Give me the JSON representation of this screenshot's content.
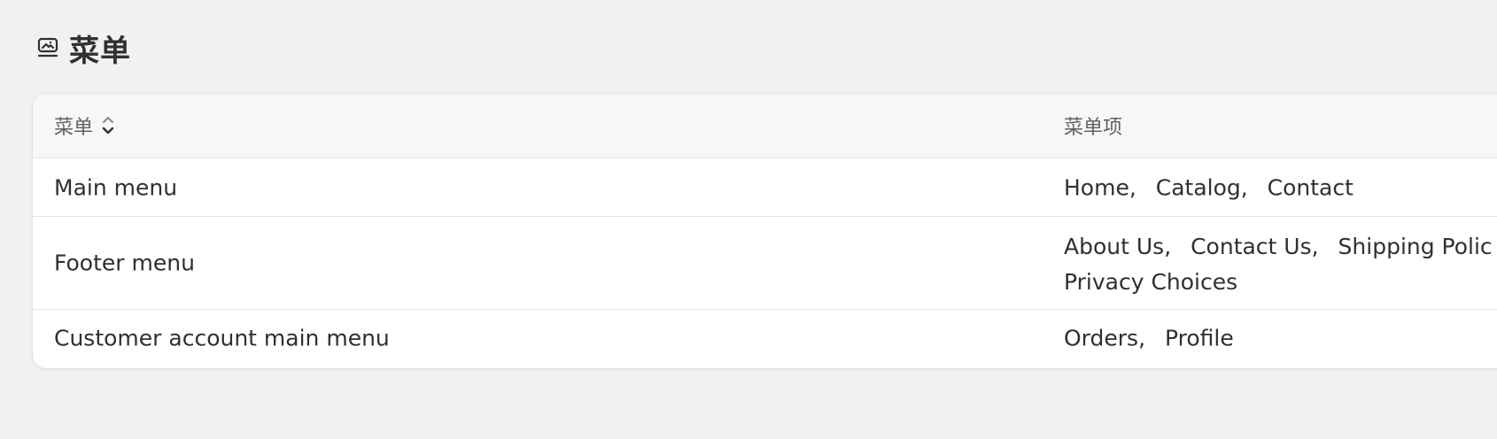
{
  "header": {
    "icon": "menu-list-icon",
    "title": "菜单"
  },
  "table": {
    "columns": {
      "menu": "菜单",
      "items": "菜单项"
    },
    "sort_icon": "sort-icon",
    "separator": ",",
    "rows": [
      {
        "name": "Main menu",
        "items": [
          "Home",
          "Catalog",
          "Contact"
        ]
      },
      {
        "name": "Footer menu",
        "items": [
          "About Us",
          "Contact Us",
          "Shipping Polic",
          "Privacy Choices"
        ]
      },
      {
        "name": "Customer account main menu",
        "items": [
          "Orders",
          "Profile"
        ]
      }
    ]
  }
}
